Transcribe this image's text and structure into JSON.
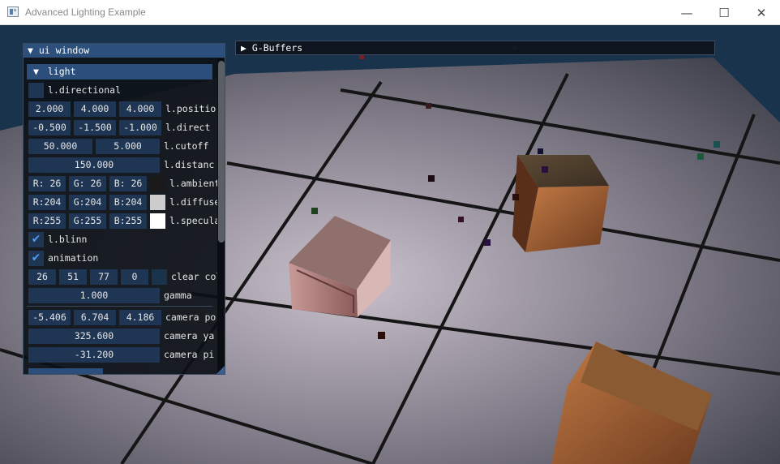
{
  "window": {
    "title": "Advanced Lighting Example",
    "minimize_glyph": "—",
    "maximize_glyph": "☐",
    "close_glyph": "✕"
  },
  "ui_window": {
    "title": "ui window",
    "light_header": "light",
    "directional_label": "l.directional",
    "position": {
      "x": "2.000",
      "y": "4.000",
      "z": "4.000",
      "label": "l.positio"
    },
    "direction": {
      "x": "-0.500",
      "y": "-1.500",
      "z": "-1.000",
      "label": "l.direct"
    },
    "cutoff": {
      "a": "50.000",
      "b": "5.000",
      "label": "l.cutoff"
    },
    "distance": {
      "value": "150.000",
      "label": "l.distanc"
    },
    "ambient": {
      "r": "R: 26",
      "g": "G: 26",
      "b": "B: 26",
      "label": "l.ambient",
      "color": "#1a1a1a"
    },
    "diffuse": {
      "r": "R:204",
      "g": "G:204",
      "b": "B:204",
      "label": "l.diffuse",
      "color": "#cccccc"
    },
    "specular": {
      "r": "R:255",
      "g": "G:255",
      "b": "B:255",
      "label": "l.specula",
      "color": "#ffffff"
    },
    "blinn": {
      "label": "l.blinn",
      "checked": true
    },
    "animation": {
      "label": "animation",
      "checked": true
    },
    "clear_color": {
      "r": "26",
      "g": "51",
      "b": "77",
      "a": "0",
      "label": "clear col",
      "color": "#1a334d"
    },
    "gamma": {
      "value": "1.000",
      "label": "gamma"
    },
    "camera_pos": {
      "x": "-5.406",
      "y": "6.704",
      "z": "4.186",
      "label": "camera po"
    },
    "camera_yaw": {
      "value": "325.600",
      "label": "camera ya"
    },
    "camera_pitch": {
      "value": "-31.200",
      "label": "camera pi"
    }
  },
  "gbuffers": {
    "label": "G-Buffers"
  },
  "colors": {
    "accent": "#2c4f7c",
    "field_bg": "#1e3553",
    "check": "#4f98f0"
  },
  "icons": {
    "collapse": "triangle-down-icon",
    "expand": "triangle-right-icon",
    "check": "checkmark-icon"
  }
}
